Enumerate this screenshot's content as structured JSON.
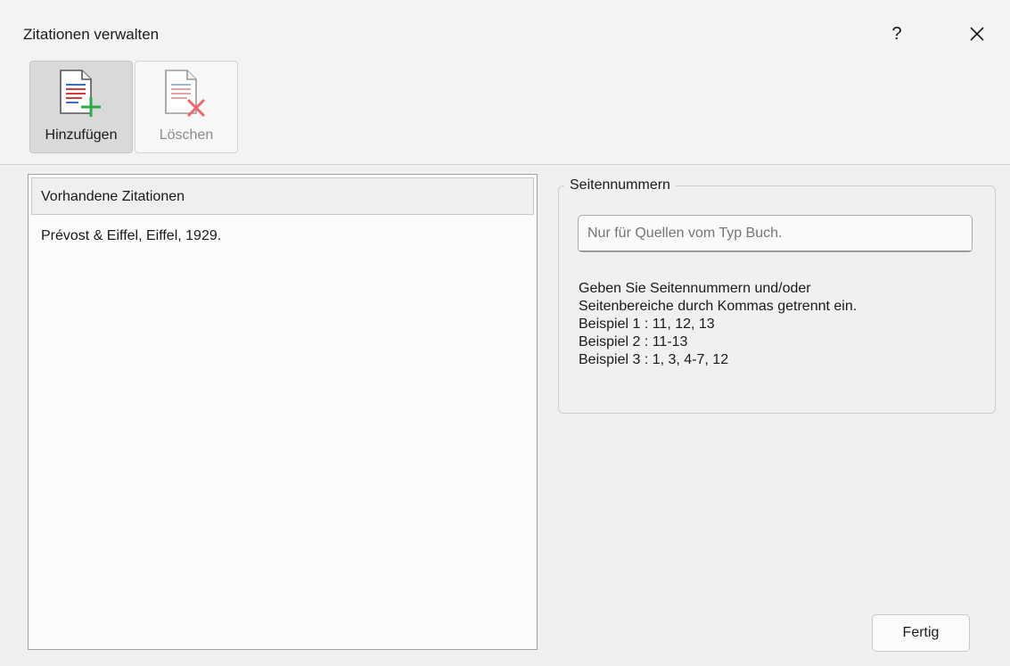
{
  "window": {
    "title": "Zitationen verwalten",
    "help_label": "?"
  },
  "toolbar": {
    "add_label": "Hinzufügen",
    "delete_label": "Löschen"
  },
  "list": {
    "header": "Vorhandene Zitationen",
    "items": [
      "Prévost & Eiffel, Eiffel, 1929."
    ]
  },
  "page_numbers": {
    "legend": "Seitennummern",
    "placeholder": "Nur für Quellen vom Typ Buch.",
    "hint_lines": [
      "Geben Sie Seitennummern und/oder",
      "Seitenbereiche durch Kommas getrennt ein.",
      "Beispiel 1 : 11, 12, 13",
      "Beispiel 2 : 11-13",
      "Beispiel 3 : 1, 3, 4-7, 12"
    ]
  },
  "footer": {
    "done_label": "Fertig"
  },
  "icons": {
    "add": "document-add-icon",
    "delete": "document-delete-icon",
    "close": "close-icon"
  },
  "colors": {
    "add_plus": "#2aa84a",
    "delete_x": "#e05a5a",
    "doc_lines_red": "#d43c3c",
    "doc_lines_blue": "#3a6fc4"
  }
}
